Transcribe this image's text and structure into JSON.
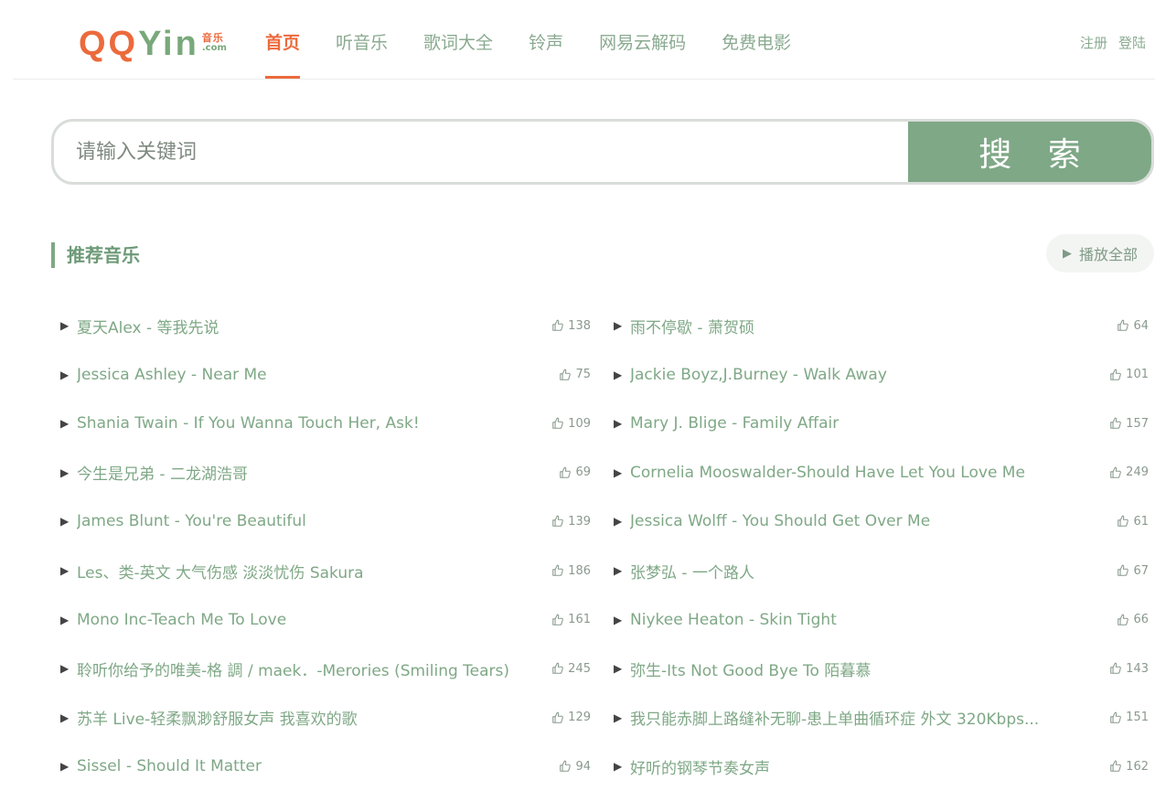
{
  "brand": {
    "logo_q": "QQ",
    "logo_yin": "Yin",
    "logo_cn": "音乐",
    "logo_com": ".com",
    "colors": {
      "orange": "#ec6a3c",
      "green": "#7fa886"
    }
  },
  "nav": {
    "items": [
      {
        "label": "首页",
        "active": true
      },
      {
        "label": "听音乐"
      },
      {
        "label": "歌词大全"
      },
      {
        "label": "铃声"
      },
      {
        "label": "网易云解码"
      },
      {
        "label": "免费电影"
      }
    ]
  },
  "auth": {
    "register": "注册",
    "login": "登陆"
  },
  "search": {
    "placeholder": "请输入关键词",
    "button": "搜 索"
  },
  "section": {
    "title": "推荐音乐",
    "play_all": "播放全部"
  },
  "songs": [
    {
      "title": "夏天Alex - 等我先说",
      "likes": "138"
    },
    {
      "title": "雨不停歇 - 萧贺硕",
      "likes": "64"
    },
    {
      "title": "Jessica Ashley - Near Me",
      "likes": "75"
    },
    {
      "title": "Jackie Boyz,J.Burney - Walk Away",
      "likes": "101"
    },
    {
      "title": "Shania Twain - If You Wanna Touch Her, Ask!",
      "likes": "109"
    },
    {
      "title": "Mary J. Blige - Family Affair",
      "likes": "157"
    },
    {
      "title": "今生是兄弟 - 二龙湖浩哥",
      "likes": "69"
    },
    {
      "title": "Cornelia Mooswalder-Should Have Let You Love Me",
      "likes": "249"
    },
    {
      "title": "James Blunt - You're Beautiful",
      "likes": "139"
    },
    {
      "title": "Jessica Wolff - You Should Get Over Me",
      "likes": "61"
    },
    {
      "title": "Les、类-英文 大气伤感 淡淡忧伤 Sakura",
      "likes": "186"
    },
    {
      "title": "张梦弘 - 一个路人",
      "likes": "67"
    },
    {
      "title": "Mono Inc-Teach Me To Love",
      "likes": "161"
    },
    {
      "title": "Niykee Heaton - Skin Tight",
      "likes": "66"
    },
    {
      "title": "聆听你给予的唯美-格 調 / maek．-Merories (Smiling Tears)",
      "likes": "245"
    },
    {
      "title": "弥生-Its Not Good Bye To 陌暮慕",
      "likes": "143"
    },
    {
      "title": "苏羊 Live-轻柔飘渺舒服女声 我喜欢的歌",
      "likes": "129"
    },
    {
      "title": "我只能赤脚上路缝补无聊-患上单曲循环症 外文 320Kbps...",
      "likes": "151"
    },
    {
      "title": "Sissel - Should It Matter",
      "likes": "94"
    },
    {
      "title": "好听的钢琴节奏女声",
      "likes": "162"
    }
  ]
}
